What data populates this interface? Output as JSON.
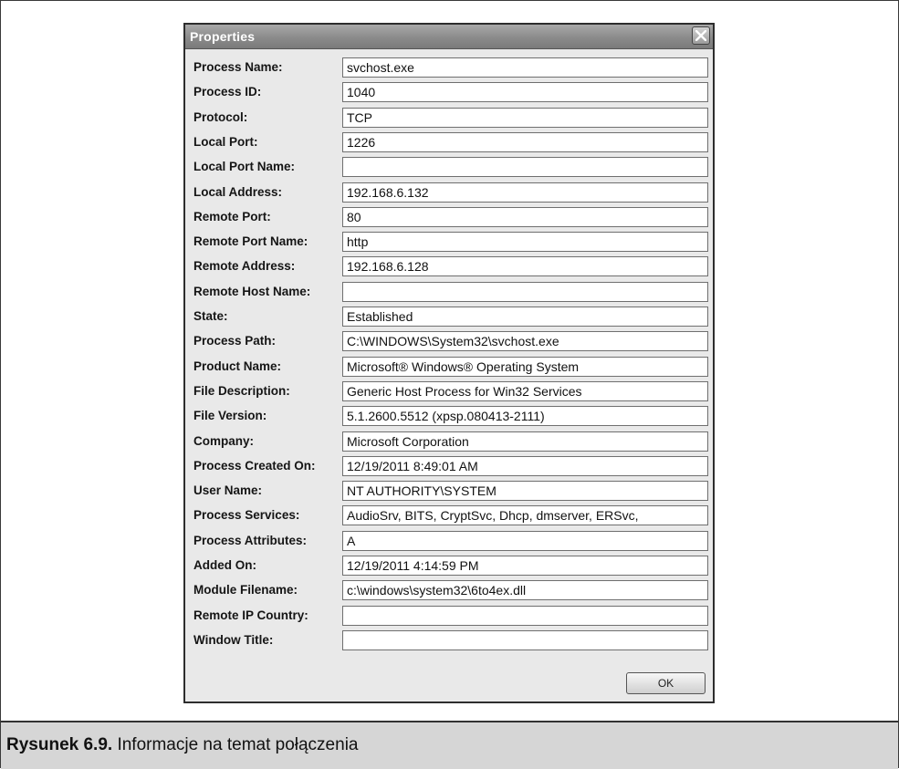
{
  "dialog": {
    "title": "Properties",
    "close_icon": "close-icon",
    "ok_label": "OK",
    "fields": [
      {
        "label": "Process Name:",
        "value": "svchost.exe"
      },
      {
        "label": "Process ID:",
        "value": "1040"
      },
      {
        "label": "Protocol:",
        "value": "TCP"
      },
      {
        "label": "Local Port:",
        "value": "1226"
      },
      {
        "label": "Local Port Name:",
        "value": ""
      },
      {
        "label": "Local Address:",
        "value": "192.168.6.132"
      },
      {
        "label": "Remote Port:",
        "value": "80"
      },
      {
        "label": "Remote Port Name:",
        "value": "http"
      },
      {
        "label": "Remote Address:",
        "value": "192.168.6.128"
      },
      {
        "label": "Remote Host Name:",
        "value": ""
      },
      {
        "label": "State:",
        "value": "Established"
      },
      {
        "label": "Process Path:",
        "value": "C:\\WINDOWS\\System32\\svchost.exe"
      },
      {
        "label": "Product Name:",
        "value": "Microsoft® Windows® Operating System"
      },
      {
        "label": "File Description:",
        "value": "Generic Host Process for Win32 Services"
      },
      {
        "label": "File Version:",
        "value": "5.1.2600.5512 (xpsp.080413-2111)"
      },
      {
        "label": "Company:",
        "value": "Microsoft Corporation"
      },
      {
        "label": "Process Created On:",
        "value": "12/19/2011 8:49:01 AM"
      },
      {
        "label": "User Name:",
        "value": "NT AUTHORITY\\SYSTEM"
      },
      {
        "label": "Process Services:",
        "value": "AudioSrv, BITS, CryptSvc, Dhcp, dmserver, ERSvc,"
      },
      {
        "label": "Process Attributes:",
        "value": "A"
      },
      {
        "label": "Added On:",
        "value": "12/19/2011 4:14:59 PM"
      },
      {
        "label": "Module Filename:",
        "value": "c:\\windows\\system32\\6to4ex.dll"
      },
      {
        "label": "Remote IP Country:",
        "value": ""
      },
      {
        "label": "Window Title:",
        "value": ""
      }
    ]
  },
  "caption": {
    "number": "Rysunek 6.9.",
    "text": " Informacje na temat połączenia"
  }
}
